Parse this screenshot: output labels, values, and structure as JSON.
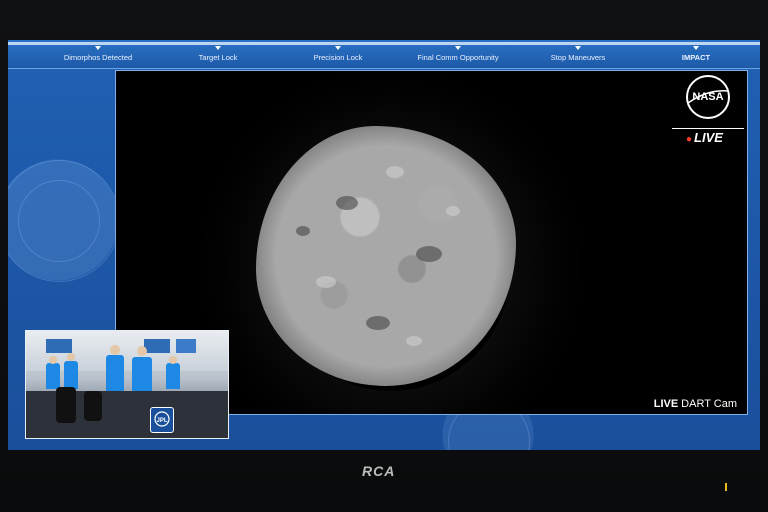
{
  "progress": {
    "stages": [
      "Dimorphos Detected",
      "Target Lock",
      "Precision Lock",
      "Final Comm Opportunity",
      "Stop Maneuvers",
      "IMPACT"
    ]
  },
  "feed": {
    "logo": "NASA",
    "live_label": "LIVE",
    "cam_label_live": "LIVE",
    "cam_label_name": "DART Cam"
  },
  "inset": {
    "badge": "JPL"
  },
  "monitor": {
    "brand": "RCA"
  },
  "colors": {
    "screen_blue": "#1d57a8",
    "live_dot": "#ff3b30",
    "power_led": "#e7b820"
  },
  "icons": [
    "nasa-logo-icon",
    "jpl-badge-icon"
  ]
}
